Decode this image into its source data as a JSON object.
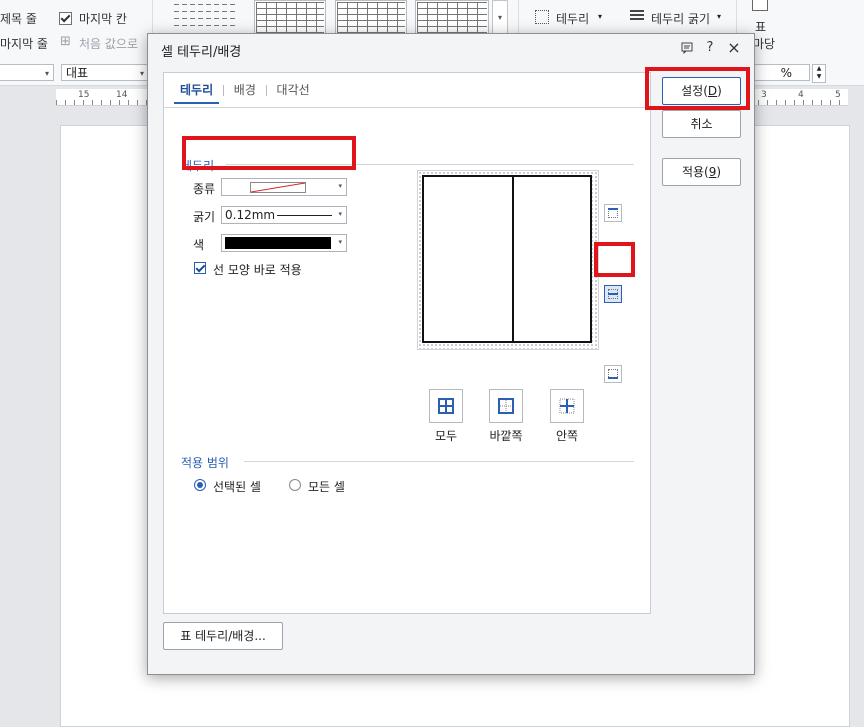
{
  "ribbon": {
    "row1_left": "제목 줄",
    "row2_left": "마지막 줄",
    "last_col_label": "마지막 칸",
    "reset_label": "처음 값으로",
    "border_btn": "테두리",
    "border_weight_btn": "테두리 굵기",
    "table_label": "표",
    "table_sub": "마당"
  },
  "toolbar": {
    "style_combo": "대표",
    "zoom_unit": "%"
  },
  "ruler": {
    "left_nums": [
      "15",
      "14"
    ],
    "right_nums": [
      "3",
      "4",
      "5"
    ]
  },
  "dialog": {
    "title": "셀 테두리/배경",
    "title_buttons": {
      "help": "?",
      "close": "×"
    },
    "tabs": [
      {
        "label": "테두리",
        "active": true
      },
      {
        "label": "배경",
        "active": false
      },
      {
        "label": "대각선",
        "active": false
      }
    ],
    "border_group": {
      "label": "테두리",
      "type_label": "종류",
      "weight_label": "굵기",
      "weight_value": "0.12mm",
      "color_label": "색",
      "color_value": "#000000",
      "apply_shape_label": "선 모양 바로 적용",
      "apply_shape_checked": true
    },
    "presets": [
      {
        "label": "모두",
        "icon": "all-borders-icon"
      },
      {
        "label": "바깥쪽",
        "icon": "outer-borders-icon"
      },
      {
        "label": "안쪽",
        "icon": "inner-borders-icon"
      }
    ],
    "scope_group": {
      "label": "적용 범위",
      "options": [
        {
          "label": "선택된 셀",
          "selected": true
        },
        {
          "label": "모든 셀",
          "selected": false
        }
      ]
    },
    "table_border_button": "표 테두리/배경...",
    "buttons": {
      "ok": "설정",
      "ok_key": "D",
      "cancel": "취소",
      "apply": "적용",
      "apply_key": "9"
    },
    "highlight_color": "#e0151c",
    "accent_color": "#2b5fb3"
  }
}
